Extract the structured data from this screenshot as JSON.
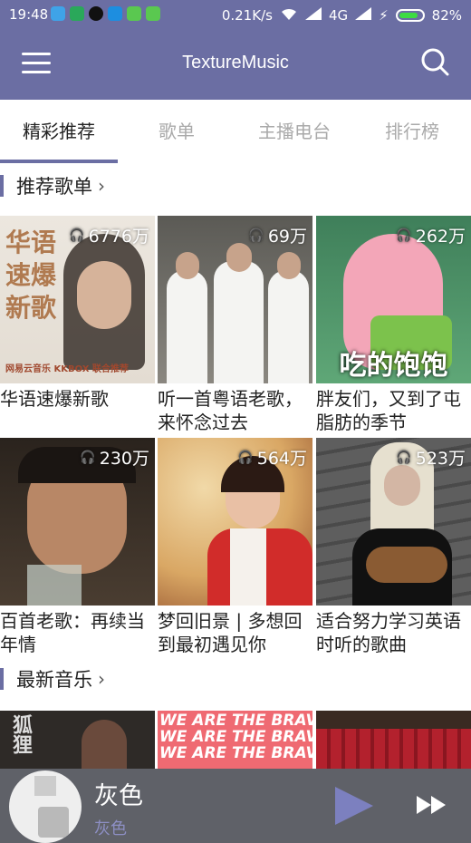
{
  "status": {
    "time": "19:48",
    "speed": "0.21K/s",
    "network": "4G",
    "battery": "82%"
  },
  "appbar": {
    "title": "TextureMusic"
  },
  "tabs": [
    {
      "label": "精彩推荐"
    },
    {
      "label": "歌单"
    },
    {
      "label": "主播电台"
    },
    {
      "label": "排行榜"
    }
  ],
  "sections": {
    "recommended": {
      "title": "推荐歌单",
      "chevron": "›"
    },
    "latest": {
      "title": "最新音乐",
      "chevron": "›"
    }
  },
  "playlists": [
    {
      "name": "华语速爆新歌",
      "plays": "6776万",
      "cover_text": "华语\n速爆\n新歌",
      "cover_foot": "网易云音乐 KKBOX 联合推荐"
    },
    {
      "name": "听一首粤语老歌，来怀念过去",
      "plays": "69万"
    },
    {
      "name": "胖友们，又到了屯脂肪的季节",
      "plays": "262万",
      "cover_text": "吃的饱饱"
    },
    {
      "name": "百首老歌：再续当年情",
      "plays": "230万"
    },
    {
      "name": "梦回旧景 | 多想回到最初遇见你",
      "plays": "564万"
    },
    {
      "name": "适合努力学习英语时听的歌曲",
      "plays": "523万"
    }
  ],
  "latest_covers": [
    {
      "text": "狐狸"
    },
    {
      "text": "WE ARE THE BRAVE"
    },
    {
      "text": ""
    }
  ],
  "player": {
    "song": "灰色",
    "artist": "灰色"
  },
  "colors": {
    "primary": "#6B6EA3",
    "player_bg": "#5f6168",
    "accent": "#7c80bf"
  }
}
